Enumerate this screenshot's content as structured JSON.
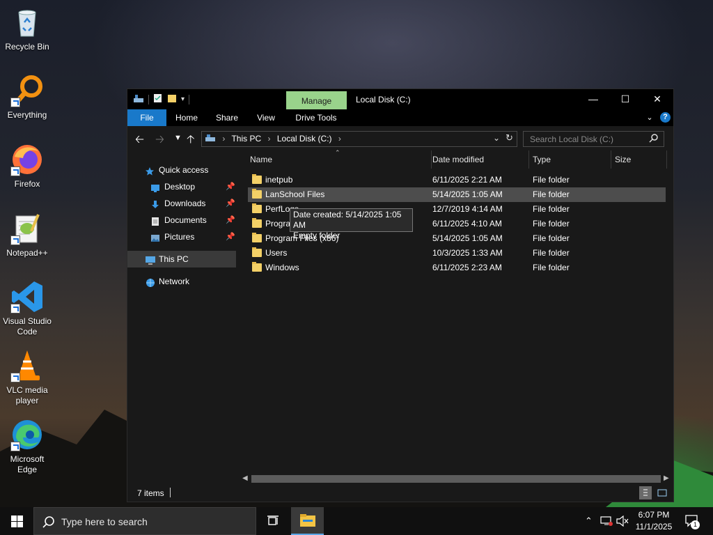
{
  "desktop": {
    "icons": [
      {
        "label": "Recycle Bin"
      },
      {
        "label": "Everything"
      },
      {
        "label": "Firefox"
      },
      {
        "label": "Notepad++"
      },
      {
        "label": "Visual Studio Code"
      },
      {
        "label": "VLC media player"
      },
      {
        "label": "Microsoft Edge"
      }
    ]
  },
  "window": {
    "title": "Local Disk (C:)",
    "manage_label": "Manage",
    "ribbon_tabs": [
      "File",
      "Home",
      "Share",
      "View",
      "Drive Tools"
    ],
    "address": {
      "this_pc": "This PC",
      "drive": "Local Disk (C:)"
    },
    "search_placeholder": "Search Local Disk (C:)",
    "nav": {
      "quick_access": "Quick access",
      "desktop": "Desktop",
      "downloads": "Downloads",
      "documents": "Documents",
      "pictures": "Pictures",
      "this_pc": "This PC",
      "network": "Network"
    },
    "columns": {
      "name": "Name",
      "date": "Date modified",
      "type": "Type",
      "size": "Size"
    },
    "files": [
      {
        "name": "inetpub",
        "date": "6/11/2025 2:21 AM",
        "type": "File folder"
      },
      {
        "name": "LanSchool Files",
        "date": "5/14/2025 1:05 AM",
        "type": "File folder"
      },
      {
        "name": "PerfLogs",
        "date": "12/7/2019 4:14 AM",
        "type": "File folder"
      },
      {
        "name": "Program Files",
        "date": "6/11/2025 4:10 AM",
        "type": "File folder"
      },
      {
        "name": "Program Files (x86)",
        "date": "5/14/2025 1:05 AM",
        "type": "File folder"
      },
      {
        "name": "Users",
        "date": "10/3/2025 1:33 AM",
        "type": "File folder"
      },
      {
        "name": "Windows",
        "date": "6/11/2025 2:23 AM",
        "type": "File folder"
      }
    ],
    "tooltip": {
      "line1": "Date created: 5/14/2025 1:05 AM",
      "line2": "Empty folder"
    },
    "status": "7 items"
  },
  "taskbar": {
    "search_placeholder": "Type here to search",
    "time": "6:07 PM",
    "date": "11/1/2025",
    "notification_count": "1"
  }
}
